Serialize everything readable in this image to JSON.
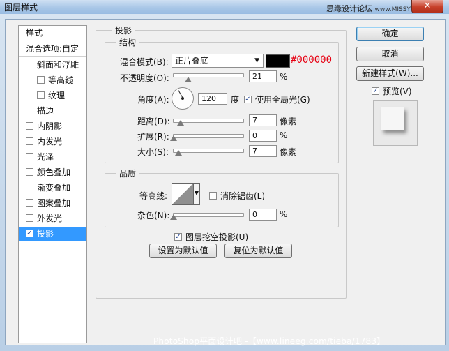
{
  "window": {
    "title": "图层样式",
    "close_glyph": "✕"
  },
  "watermark_top": {
    "text": "思缘设计论坛",
    "url": "www.MISSYUAN.COM"
  },
  "style_list": {
    "header": "样式",
    "blending": "混合选项:自定",
    "items": [
      {
        "label": "斜面和浮雕",
        "checked": false,
        "sub": false
      },
      {
        "label": "等高线",
        "checked": false,
        "sub": true
      },
      {
        "label": "纹理",
        "checked": false,
        "sub": true
      },
      {
        "label": "描边",
        "checked": false,
        "sub": false
      },
      {
        "label": "内阴影",
        "checked": false,
        "sub": false
      },
      {
        "label": "内发光",
        "checked": false,
        "sub": false
      },
      {
        "label": "光泽",
        "checked": false,
        "sub": false
      },
      {
        "label": "颜色叠加",
        "checked": false,
        "sub": false
      },
      {
        "label": "渐变叠加",
        "checked": false,
        "sub": false
      },
      {
        "label": "图案叠加",
        "checked": false,
        "sub": false
      },
      {
        "label": "外发光",
        "checked": false,
        "sub": false
      },
      {
        "label": "投影",
        "checked": true,
        "sub": false,
        "selected": true
      }
    ]
  },
  "drop_shadow": {
    "title": "投影",
    "structure": {
      "title": "结构",
      "blend_mode_label": "混合模式(B):",
      "blend_mode_value": "正片叠底",
      "color_hex": "#000000",
      "opacity_label": "不透明度(O):",
      "opacity_value": "21",
      "opacity_unit": "%",
      "angle_label": "角度(A):",
      "angle_value": "120",
      "angle_unit": "度",
      "global_light_label": "使用全局光(G)",
      "global_light_checked": true,
      "distance_label": "距离(D):",
      "distance_value": "7",
      "distance_unit": "像素",
      "spread_label": "扩展(R):",
      "spread_value": "0",
      "spread_unit": "%",
      "size_label": "大小(S):",
      "size_value": "7",
      "size_unit": "像素"
    },
    "quality": {
      "title": "品质",
      "contour_label": "等高线:",
      "anti_alias_label": "消除锯齿(L)",
      "anti_alias_checked": false,
      "noise_label": "杂色(N):",
      "noise_value": "0",
      "noise_unit": "%"
    },
    "knockout_label": "图层挖空投影(U)",
    "knockout_checked": true,
    "make_default": "设置为默认值",
    "reset_default": "复位为默认值"
  },
  "buttons": {
    "ok": "确定",
    "cancel": "取消",
    "new_style": "新建样式(W)...",
    "preview_label": "预览(V)",
    "preview_checked": true
  },
  "watermark_bottom": "PhotoShop平面设计吧 -【www.lineeg.com/tieba/1783】",
  "check_glyph": "✓",
  "arrow_glyph": "▼"
}
